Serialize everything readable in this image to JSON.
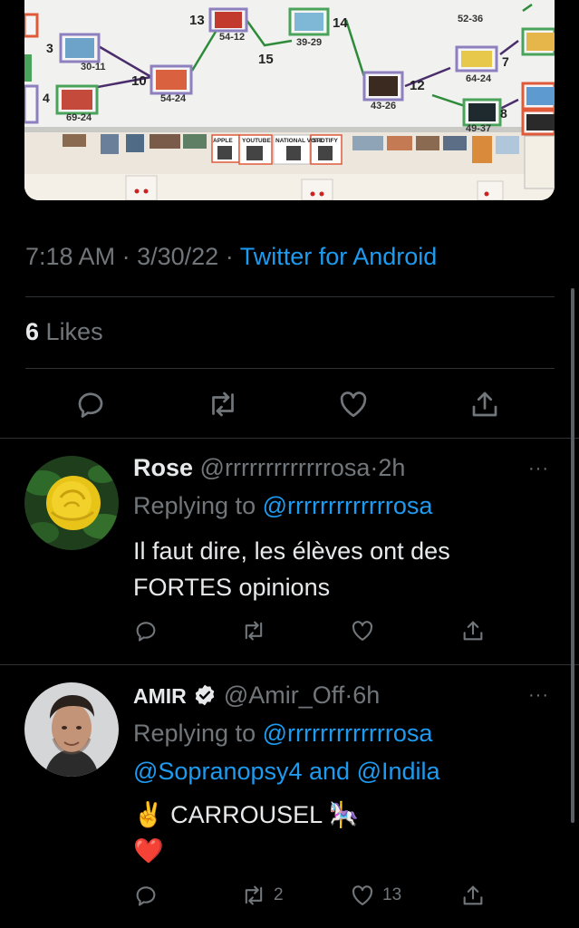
{
  "tweet": {
    "photo": {
      "bracket_numbers": [
        "13",
        "14",
        "15",
        "10",
        "12",
        "3",
        "4",
        "7",
        "8"
      ],
      "scores": [
        "54-12",
        "39-29",
        "52-36",
        "30-11",
        "54-24",
        "64-24",
        "69-24",
        "43-26",
        "49-37"
      ],
      "qr_labels": [
        "APPLE",
        "YOUTUBE",
        "NATIONAL VOTE",
        "SPOTIFY"
      ]
    },
    "time": "7:18 AM",
    "date": "3/30/22",
    "source": "Twitter for Android",
    "separator": "·",
    "likes_count": "6",
    "likes_label": "Likes"
  },
  "replies": [
    {
      "name": "Rose",
      "handle": "@rrrrrrrrrrrrrosa",
      "time": "2h",
      "replying_prefix": "Replying to",
      "replying_to_line1": "@rrrrrrrrrrrrrosa",
      "replying_to_line2": "",
      "text_line1": "Il faut dire, les élèves ont des",
      "text_line2": "FORTES opinions",
      "retweets": "",
      "likes": "",
      "avatar": "yellow-rose"
    },
    {
      "name": "AMIR",
      "verified": true,
      "handle": "@Amir_Off",
      "time": "6h",
      "replying_prefix": "Replying to",
      "replying_to_line1": "@rrrrrrrrrrrrrosa",
      "replying_to_line2": "@Sopranopsy4 and @Indila",
      "text_line1": "✌️ CARROUSEL 🎠",
      "text_line2": "❤️",
      "retweets": "2",
      "likes": "13",
      "avatar": "man-portrait"
    }
  ],
  "more_icon": "···",
  "icons": [
    "reply-icon",
    "retweet-icon",
    "like-icon",
    "share-icon",
    "more-icon",
    "verified-icon"
  ],
  "colors": {
    "background": "#000000",
    "link": "#1d9bf0",
    "muted": "#71767b",
    "text": "#e7e9ea",
    "divider": "#2f3336"
  }
}
